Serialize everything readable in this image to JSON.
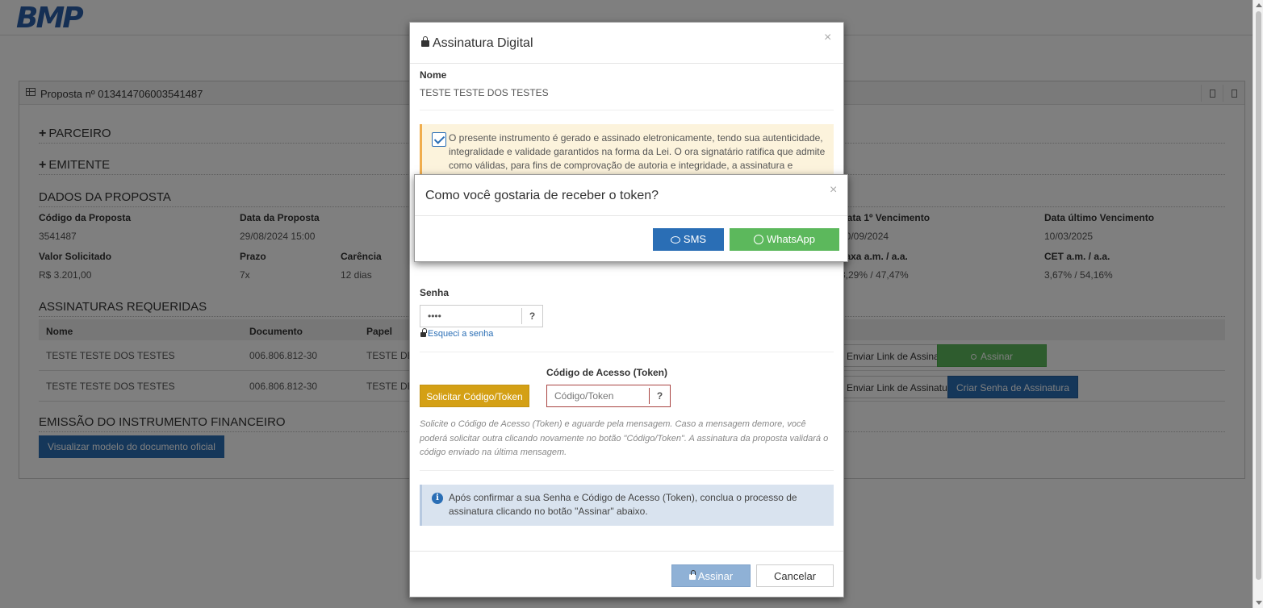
{
  "logo": {
    "text": "BMP"
  },
  "proposal": {
    "title": "Proposta nº 013414706003541487",
    "sections": {
      "partner": "PARCEIRO",
      "issuer": "EMITENTE",
      "data": "DADOS DA PROPOSTA",
      "signatures": "ASSINATURAS REQUERIDAS",
      "issuance": "EMISSÃO DO INSTRUMENTO FINANCEIRO"
    },
    "fields": {
      "code_label": "Código da Proposta",
      "code_value": "3541487",
      "date_label": "Data da Proposta",
      "date_value": "29/08/2024 15:00",
      "first_due_label": "Data 1º Vencimento",
      "first_due_value": "10/09/2024",
      "last_due_label": "Data último Vencimento",
      "last_due_value": "10/03/2025",
      "amount_label": "Valor Solicitado",
      "amount_value": "R$ 3.201,00",
      "term_label": "Prazo",
      "term_value": "7x",
      "grace_label": "Carência",
      "grace_value": "12 dias",
      "rate_label": "Taxa a.m. / a.a.",
      "rate_value": "3,29% / 47,47%",
      "cet_label": "CET a.m. / a.a.",
      "cet_value": "3,67% / 54,16%"
    },
    "table": {
      "headers": {
        "name": "Nome",
        "document": "Documento",
        "role": "Papel"
      },
      "rows": [
        {
          "name": "TESTE TESTE DOS TESTES",
          "document": "006.806.812-30",
          "role": "TESTE DE",
          "link_btn": "Enviar Link de Assinatura",
          "action_btn": "Assinar"
        },
        {
          "name": "TESTE TESTE DOS TESTES",
          "document": "006.806.812-30",
          "role": "TESTE DE",
          "link_btn": "Enviar Link de Assinatura",
          "action_btn": "Criar Senha de Assinatura"
        }
      ]
    },
    "doc_button": "Visualizar modelo do documento oficial"
  },
  "modal": {
    "title": "Assinatura Digital",
    "close": "×",
    "name_label": "Nome",
    "name_value": "TESTE TESTE DOS TESTES",
    "terms_checked": true,
    "terms_text": "O presente instrumento é gerado e assinado eletronicamente, tendo sua autenticidade, integralidade e validade garantidos na forma da Lei. O ora signatário ratifica que admite como válidas, para fins de comprovação de autoria e integridade, a assinatura e",
    "password_label": "Senha",
    "password_value": "••••",
    "password_help": "?",
    "forgot_link": "Esqueci a senha",
    "token_label": "Código de Acesso (Token)",
    "token_placeholder": "Código/Token",
    "token_help": "?",
    "request_token_btn": "Solicitar Código/Token",
    "help_text": "Solicite o Código de Acesso (Token) e aguarde pela mensagem. Caso a mensagem demore, você poderá solicitar outra clicando novamente no botão \"Código/Token\". A assinatura da proposta validará o código enviado na última mensagem.",
    "info_text": "Após confirmar a sua Senha e Código de Acesso (Token), conclua o processo de assinatura clicando no botão \"Assinar\" abaixo.",
    "sign_btn": "Assinar",
    "cancel_btn": "Cancelar"
  },
  "token_dialog": {
    "title": "Como você gostaria de receber o token?",
    "close": "×",
    "sms_btn": "SMS",
    "whatsapp_btn": "WhatsApp"
  },
  "colors": {
    "primary": "#2a6eb5",
    "success": "#5cb85c",
    "warning": "#d4a015",
    "brand": "#1c2a6b"
  }
}
